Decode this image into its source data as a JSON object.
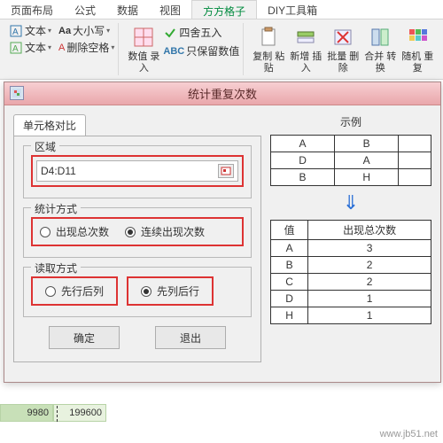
{
  "ribbon": {
    "tabs": [
      "页面布局",
      "公式",
      "数据",
      "视图",
      "方方格子",
      "DIY工具箱"
    ],
    "active_index": 4,
    "left_group": {
      "row1": {
        "text_label": "文本",
        "case_label": "大小写",
        "drop": "▾"
      },
      "row2": {
        "text_label": "文本",
        "del_spaces": "删除空格",
        "drop": "▾"
      }
    },
    "mid": {
      "count_in": "数值\n录入",
      "round": "四舍五入",
      "keep_numeric": "只保留数值",
      "drop": "▾"
    },
    "right": {
      "copy": "复制\n粘贴",
      "add": "新增\n插入",
      "batch": "批量\n删除",
      "merge": "合并\n转换",
      "rand": "随机\n重复",
      "drop": "▾"
    }
  },
  "dialog": {
    "title": "统计重复次数",
    "tab": "单元格对比",
    "region": {
      "legend": "区域",
      "value": "D4:D11"
    },
    "method": {
      "legend": "统计方式",
      "opt_total": "出现总次数",
      "opt_consec": "连续出现次数",
      "selected": "连续出现次数"
    },
    "read": {
      "legend": "读取方式",
      "opt_row": "先行后列",
      "opt_col": "先列后行",
      "selected": "先列后行"
    },
    "ok": "确定",
    "cancel": "退出"
  },
  "example": {
    "title": "示例",
    "input": [
      [
        "A",
        "B"
      ],
      [
        "D",
        "A"
      ],
      [
        "B",
        "H"
      ]
    ],
    "output_header": [
      "值",
      "出现总次数"
    ],
    "output": [
      [
        "A",
        "3"
      ],
      [
        "B",
        "2"
      ],
      [
        "C",
        "2"
      ],
      [
        "D",
        "1"
      ],
      [
        "H",
        "1"
      ]
    ]
  },
  "sheet": {
    "cells": [
      "9980",
      "199600"
    ]
  },
  "watermark": "www.jb51.net"
}
